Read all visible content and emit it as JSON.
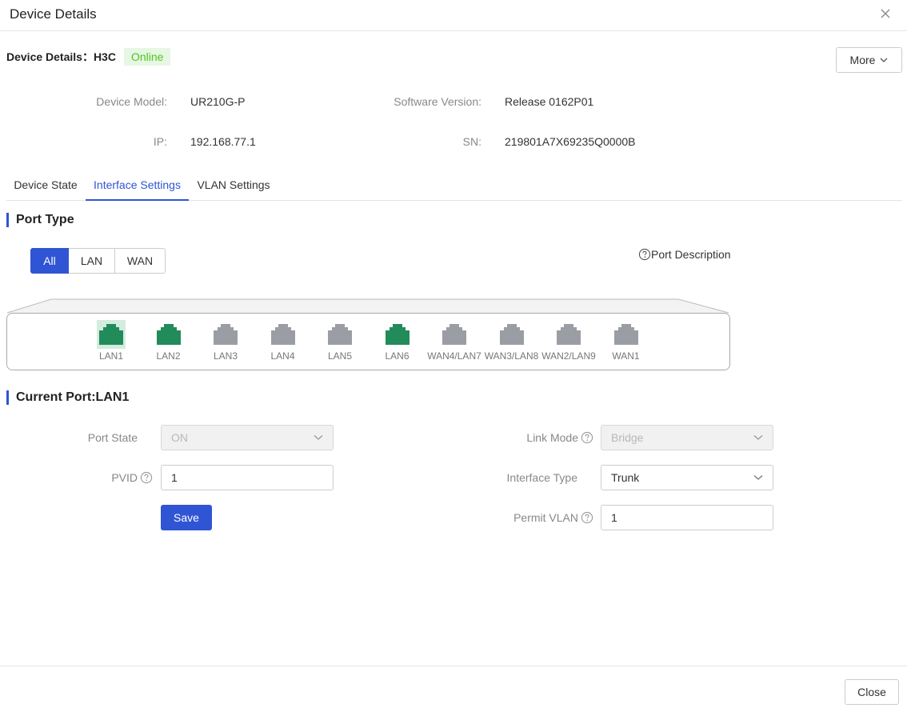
{
  "modal": {
    "title": "Device Details",
    "close_label": "Close"
  },
  "device": {
    "title": "Device Details：H3C",
    "status": "Online",
    "more_label": "More",
    "info": {
      "model_label": "Device Model:",
      "model_value": "UR210G-P",
      "software_label": "Software Version:",
      "software_value": "Release 0162P01",
      "ip_label": "IP:",
      "ip_value": "192.168.77.1",
      "sn_label": "SN:",
      "sn_value": "219801A7X69235Q0000B"
    }
  },
  "tabs": [
    "Device State",
    "Interface Settings",
    "VLAN Settings"
  ],
  "active_tab": "Interface Settings",
  "port_type": {
    "title": "Port Type",
    "filters": [
      "All",
      "LAN",
      "WAN"
    ],
    "active_filter": "All",
    "description_label": "Port Description"
  },
  "ports": [
    {
      "label": "LAN1",
      "status": "up",
      "selected": true
    },
    {
      "label": "LAN2",
      "status": "up",
      "selected": false
    },
    {
      "label": "LAN3",
      "status": "down",
      "selected": false
    },
    {
      "label": "LAN4",
      "status": "down",
      "selected": false
    },
    {
      "label": "LAN5",
      "status": "down",
      "selected": false
    },
    {
      "label": "LAN6",
      "status": "up",
      "selected": false
    },
    {
      "label": "WAN4/LAN7",
      "status": "down",
      "selected": false
    },
    {
      "label": "WAN3/LAN8",
      "status": "down",
      "selected": false
    },
    {
      "label": "WAN2/LAN9",
      "status": "down",
      "selected": false
    },
    {
      "label": "WAN1",
      "status": "down",
      "selected": false
    }
  ],
  "colors": {
    "accent": "#2f55d4",
    "port_up": "#228b5a",
    "port_down": "#9a9da4",
    "online": "#52c41a"
  },
  "current_port": {
    "title": "Current Port:LAN1",
    "port_state_label": "Port State",
    "port_state_value": "ON",
    "pvid_label": "PVID",
    "pvid_value": "1",
    "save_label": "Save",
    "link_mode_label": "Link Mode",
    "link_mode_value": "Bridge",
    "interface_type_label": "Interface Type",
    "interface_type_value": "Trunk",
    "permit_vlan_label": "Permit VLAN",
    "permit_vlan_value": "1"
  }
}
